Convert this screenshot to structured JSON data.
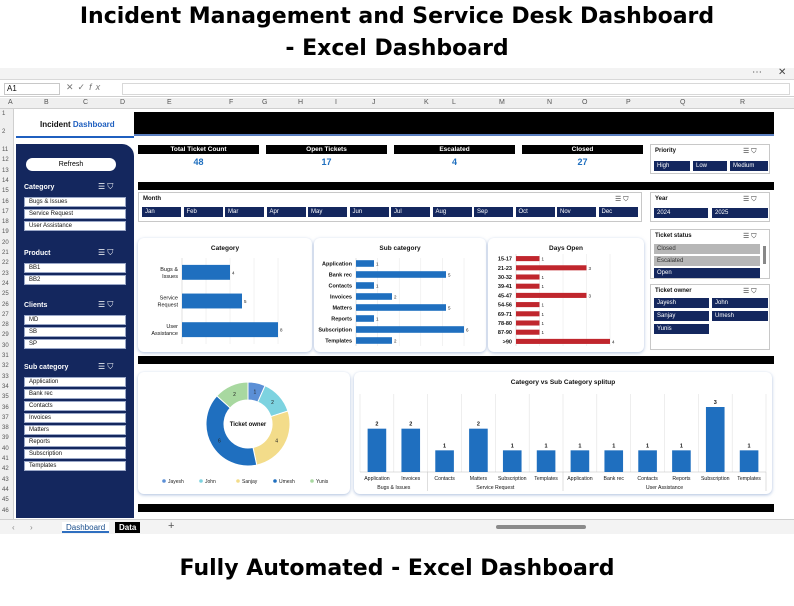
{
  "headline": {
    "line1": "Incident Management and Service Desk Dashboard",
    "line2": "- Excel Dashboard",
    "footer": "Fully Automated - Excel Dashboard"
  },
  "excel": {
    "cell_ref": "A1",
    "fx": "fx",
    "columns": [
      "A",
      "B",
      "C",
      "D",
      "E",
      "F",
      "G",
      "H",
      "I",
      "J",
      "K",
      "L",
      "M",
      "N",
      "O",
      "P",
      "Q",
      "R"
    ],
    "rows": [
      "1",
      "2",
      "11",
      "12",
      "13",
      "14",
      "15",
      "16",
      "17",
      "18",
      "19",
      "20",
      "21",
      "22",
      "23",
      "24",
      "25",
      "26",
      "27",
      "28",
      "29",
      "30",
      "31",
      "32",
      "33",
      "34",
      "35",
      "36",
      "37",
      "38",
      "39",
      "40",
      "41",
      "42",
      "43",
      "44",
      "45",
      "46"
    ],
    "sheet_tabs": [
      "Dashboard",
      "Data"
    ],
    "add_tab": "+"
  },
  "dashboard": {
    "title_plain": "Incident ",
    "title_accent": "Dashboard",
    "refresh_label": "Refresh"
  },
  "slicers": {
    "category": {
      "title": "Category",
      "items": [
        "Bugs & Issues",
        "Service Request",
        "User Assistance"
      ]
    },
    "product": {
      "title": "Product",
      "items": [
        "BB1",
        "BB2"
      ]
    },
    "clients": {
      "title": "Clients",
      "items": [
        "MD",
        "SB",
        "SP"
      ]
    },
    "sub_category": {
      "title": "Sub category",
      "items": [
        "Application",
        "Bank rec",
        "Contacts",
        "Invoices",
        "Matters",
        "Reports",
        "Subscription",
        "Templates"
      ]
    },
    "priority": {
      "title": "Priority",
      "items": [
        "High",
        "Low",
        "Medium"
      ]
    },
    "month": {
      "title": "Month",
      "items": [
        "Jan",
        "Feb",
        "Mar",
        "Apr",
        "May",
        "Jun",
        "Jul",
        "Aug",
        "Sep",
        "Oct",
        "Nov",
        "Dec"
      ]
    },
    "year": {
      "title": "Year",
      "items": [
        "2024",
        "2025"
      ]
    },
    "ticket_status": {
      "title": "Ticket status",
      "items": [
        "Closed",
        "Escalated",
        "Open"
      ]
    },
    "ticket_owner": {
      "title": "Ticket owner",
      "items": [
        "Jayesh",
        "John",
        "Sanjay",
        "Umesh",
        "Yunis"
      ]
    }
  },
  "kpis": [
    {
      "label": "Total Ticket Count",
      "value": "48"
    },
    {
      "label": "Open Tickets",
      "value": "17"
    },
    {
      "label": "Escalated",
      "value": "4"
    },
    {
      "label": "Closed",
      "value": "27"
    }
  ],
  "colors": {
    "navy": "#14275e",
    "bar_blue": "#1f6fbf",
    "bar_red": "#c0262d",
    "accent": "#1f5fbf"
  },
  "chart_data": [
    {
      "type": "bar",
      "orientation": "horizontal",
      "title": "Category",
      "categories": [
        "Bugs & Issues",
        "Service Request",
        "User Assistance"
      ],
      "values": [
        4,
        5,
        8
      ]
    },
    {
      "type": "bar",
      "orientation": "horizontal",
      "title": "Sub category",
      "categories": [
        "Application",
        "Bank rec",
        "Contacts",
        "Invoices",
        "Matters",
        "Reports",
        "Subscription",
        "Templates"
      ],
      "values": [
        1,
        5,
        1,
        2,
        5,
        1,
        6,
        2
      ]
    },
    {
      "type": "bar",
      "orientation": "horizontal",
      "title": "Days Open",
      "categories": [
        "15-17",
        "21-23",
        "30-32",
        "39-41",
        "45-47",
        "54-56",
        "69-71",
        "78-80",
        "87-90",
        ">90"
      ],
      "values": [
        1,
        3,
        1,
        1,
        3,
        1,
        1,
        1,
        1,
        4
      ]
    },
    {
      "type": "pie",
      "title": "Ticket owner",
      "categories": [
        "Jayesh",
        "John",
        "Sanjay",
        "Umesh",
        "Yunis"
      ],
      "values": [
        1,
        2,
        4,
        6,
        2
      ],
      "colors": [
        "#5b8fd6",
        "#7dd3e0",
        "#f3dc8a",
        "#1f6fbf",
        "#a8d8a0"
      ]
    },
    {
      "type": "bar",
      "title": "Category vs Sub Category splitup",
      "categories": [
        "Application",
        "Invoices",
        "Contacts",
        "Matters",
        "Subscription",
        "Templates",
        "Application",
        "Bank rec",
        "Contacts",
        "Reports",
        "Subscription",
        "Templates"
      ],
      "groups": [
        {
          "name": "Bugs & Issues",
          "count": 2
        },
        {
          "name": "Service Request",
          "count": 4
        },
        {
          "name": "User Assistance",
          "count": 6
        }
      ],
      "values": [
        2,
        2,
        1,
        2,
        1,
        1,
        1,
        1,
        1,
        1,
        3,
        1
      ],
      "ylim": [
        0,
        3.6
      ]
    }
  ]
}
